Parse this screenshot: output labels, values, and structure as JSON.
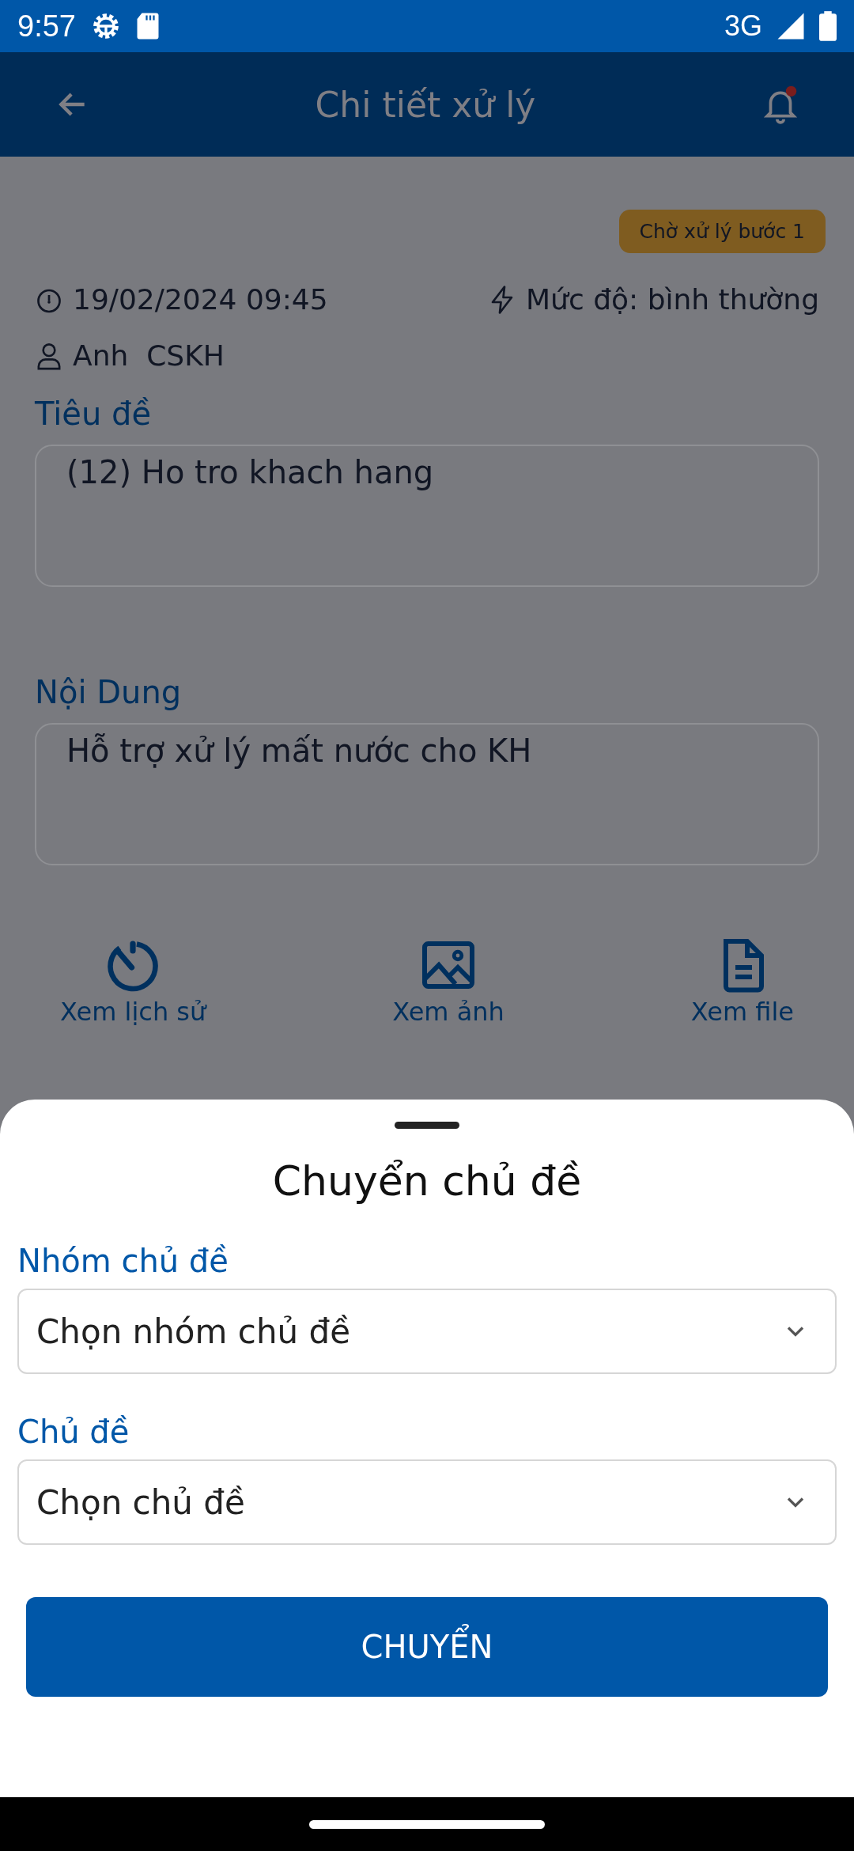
{
  "status_bar": {
    "time": "9:57",
    "network": "3G"
  },
  "app_bar": {
    "title": "Chi tiết xử lý",
    "notification_dot": true
  },
  "status_badge": "Chờ xử lý bước 1",
  "info": {
    "datetime": "19/02/2024 09:45",
    "priority": "Mức độ: bình thường",
    "person": "Anh  CSKH"
  },
  "fields": [
    {
      "label": "Tiêu đề",
      "value": "(12) Ho tro khach hang"
    },
    {
      "label": "Nội Dung",
      "value": "Hỗ trợ xử lý mất nước cho KH"
    }
  ],
  "actions": [
    {
      "kind": "history",
      "label": "Xem lịch sử"
    },
    {
      "kind": "image",
      "label": "Xem ảnh"
    },
    {
      "kind": "file",
      "label": "Xem file"
    }
  ],
  "sheet": {
    "title": "Chuyển chủ đề",
    "selects": [
      {
        "label": "Nhóm chủ đề",
        "placeholder": "Chọn nhóm chủ đề"
      },
      {
        "label": "Chủ đề",
        "placeholder": "Chọn chủ đề"
      }
    ],
    "button": "CHUYỂN"
  }
}
